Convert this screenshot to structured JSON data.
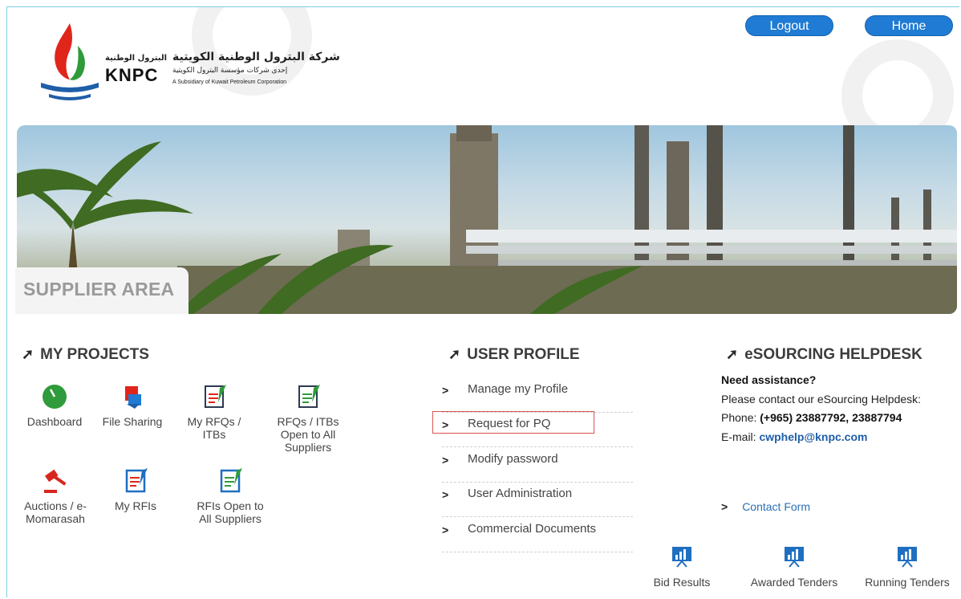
{
  "header": {
    "logo_arabic_main": "شركة البترول الوطنية الكويتية",
    "logo_arabic_short": "البترول الوطنية",
    "logo_arabic_sub": "إحدى شركات مؤسسة البترول الكويتية",
    "logo_knpc": "KNPC",
    "logo_subsidiary": "A Subsidiary of Kuwait Petroleum Corporation",
    "logout_label": "Logout",
    "home_label": "Home"
  },
  "banner": {
    "title": "SUPPLIER AREA"
  },
  "projects": {
    "heading": "MY PROJECTS",
    "items": [
      {
        "label_1": "Dashboard",
        "label_2": "",
        "label_3": ""
      },
      {
        "label_1": "File Sharing",
        "label_2": "",
        "label_3": ""
      },
      {
        "label_1": "My RFQs /",
        "label_2": "ITBs",
        "label_3": ""
      },
      {
        "label_1": "RFQs / ITBs",
        "label_2": "Open to All",
        "label_3": "Suppliers"
      },
      {
        "label_1": "Auctions / e-",
        "label_2": "Momarasah",
        "label_3": ""
      },
      {
        "label_1": "My RFIs",
        "label_2": "",
        "label_3": ""
      },
      {
        "label_1": "RFIs Open to",
        "label_2": "All Suppliers",
        "label_3": ""
      }
    ]
  },
  "profile": {
    "heading": "USER PROFILE",
    "items": [
      "Manage my Profile",
      "Request for PQ",
      "Modify password",
      "User Administration",
      "Commercial Documents"
    ],
    "highlighted_item": "Request for PQ"
  },
  "helpdesk": {
    "heading": "eSOURCING HELPDESK",
    "need": "Need assistance?",
    "contact_text": "Please contact our eSourcing Helpdesk:",
    "phone_label": "Phone: ",
    "phone_value": "(+965) 23887792, 23887794",
    "email_label": "E-mail: ",
    "email_value": "cwphelp@knpc.com",
    "contact_form": "Contact Form"
  },
  "bottom_links": [
    "Bid Results",
    "Awarded Tenders",
    "Running Tenders"
  ],
  "colors": {
    "accent_blue": "#1f7bd3",
    "highlight_red": "#d9534f",
    "link_blue": "#1f5ea8"
  }
}
